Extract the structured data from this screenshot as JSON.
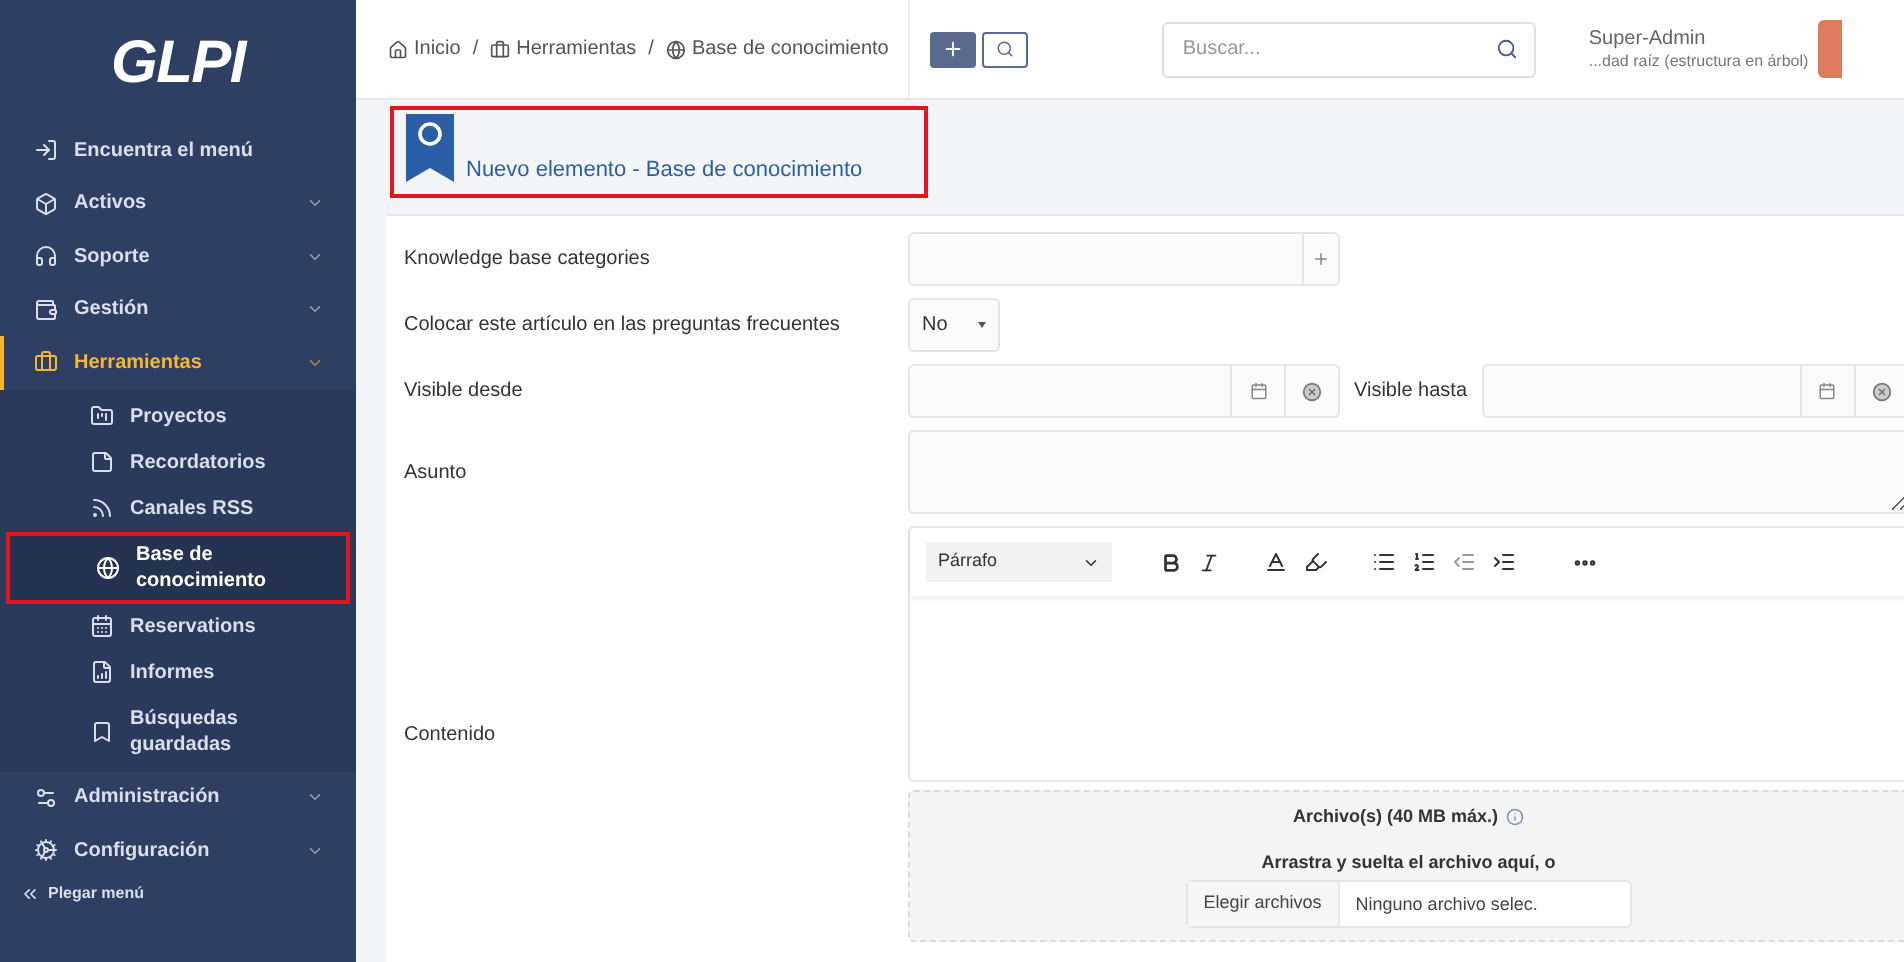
{
  "sidebar": {
    "logo": "GLPI",
    "items": [
      {
        "label": "Encuentra el menú",
        "has_submenu": false,
        "selected": false
      },
      {
        "label": "Activos",
        "has_submenu": true,
        "selected": false
      },
      {
        "label": "Soporte",
        "has_submenu": true,
        "selected": false
      },
      {
        "label": "Gestión",
        "has_submenu": true,
        "selected": false
      },
      {
        "label": "Herramientas",
        "has_submenu": true,
        "selected": true,
        "children": [
          {
            "label": "Proyectos",
            "selected": false,
            "highlighted": false
          },
          {
            "label": "Recordatorios",
            "selected": false,
            "highlighted": false
          },
          {
            "label": "Canales RSS",
            "selected": false,
            "highlighted": false
          },
          {
            "label": "Base de conocimiento",
            "selected": true,
            "highlighted": true
          },
          {
            "label": "Reservations",
            "selected": false,
            "highlighted": false
          },
          {
            "label": "Informes",
            "selected": false,
            "highlighted": false
          },
          {
            "label": "Búsquedas guardadas",
            "selected": false,
            "highlighted": false
          }
        ]
      },
      {
        "label": "Administración",
        "has_submenu": true,
        "selected": false
      },
      {
        "label": "Configuración",
        "has_submenu": true,
        "selected": false
      }
    ],
    "collapse": "Plegar menú"
  },
  "topbar": {
    "breadcrumbs": [
      "Inicio",
      "Herramientas",
      "Base de conocimiento"
    ],
    "separators": [
      "/",
      "/"
    ],
    "search": {
      "placeholder": "Buscar..."
    },
    "user": {
      "name": "Super-Admin",
      "entity": "...dad raíz (estructura en árbol)"
    }
  },
  "form": {
    "title": "Nuevo elemento - Base de conocimiento",
    "highlighted": true,
    "categories": {
      "label": "Knowledge base categories"
    },
    "faq": {
      "label": "Colocar este artículo en las preguntas frecuentes",
      "value": "No"
    },
    "visible_from": {
      "label": "Visible desde"
    },
    "visible_to": {
      "label": "Visible hasta"
    },
    "subject": {
      "label": "Asunto"
    },
    "content": {
      "label": "Contenido",
      "format": "Párrafo"
    },
    "attachments": {
      "title": "Archivo(s) (40 MB máx.)",
      "drop_text": "Arrastra y suelta el archivo aquí, o",
      "button": "Elegir archivos",
      "status": "Ninguno archivo selec."
    }
  }
}
